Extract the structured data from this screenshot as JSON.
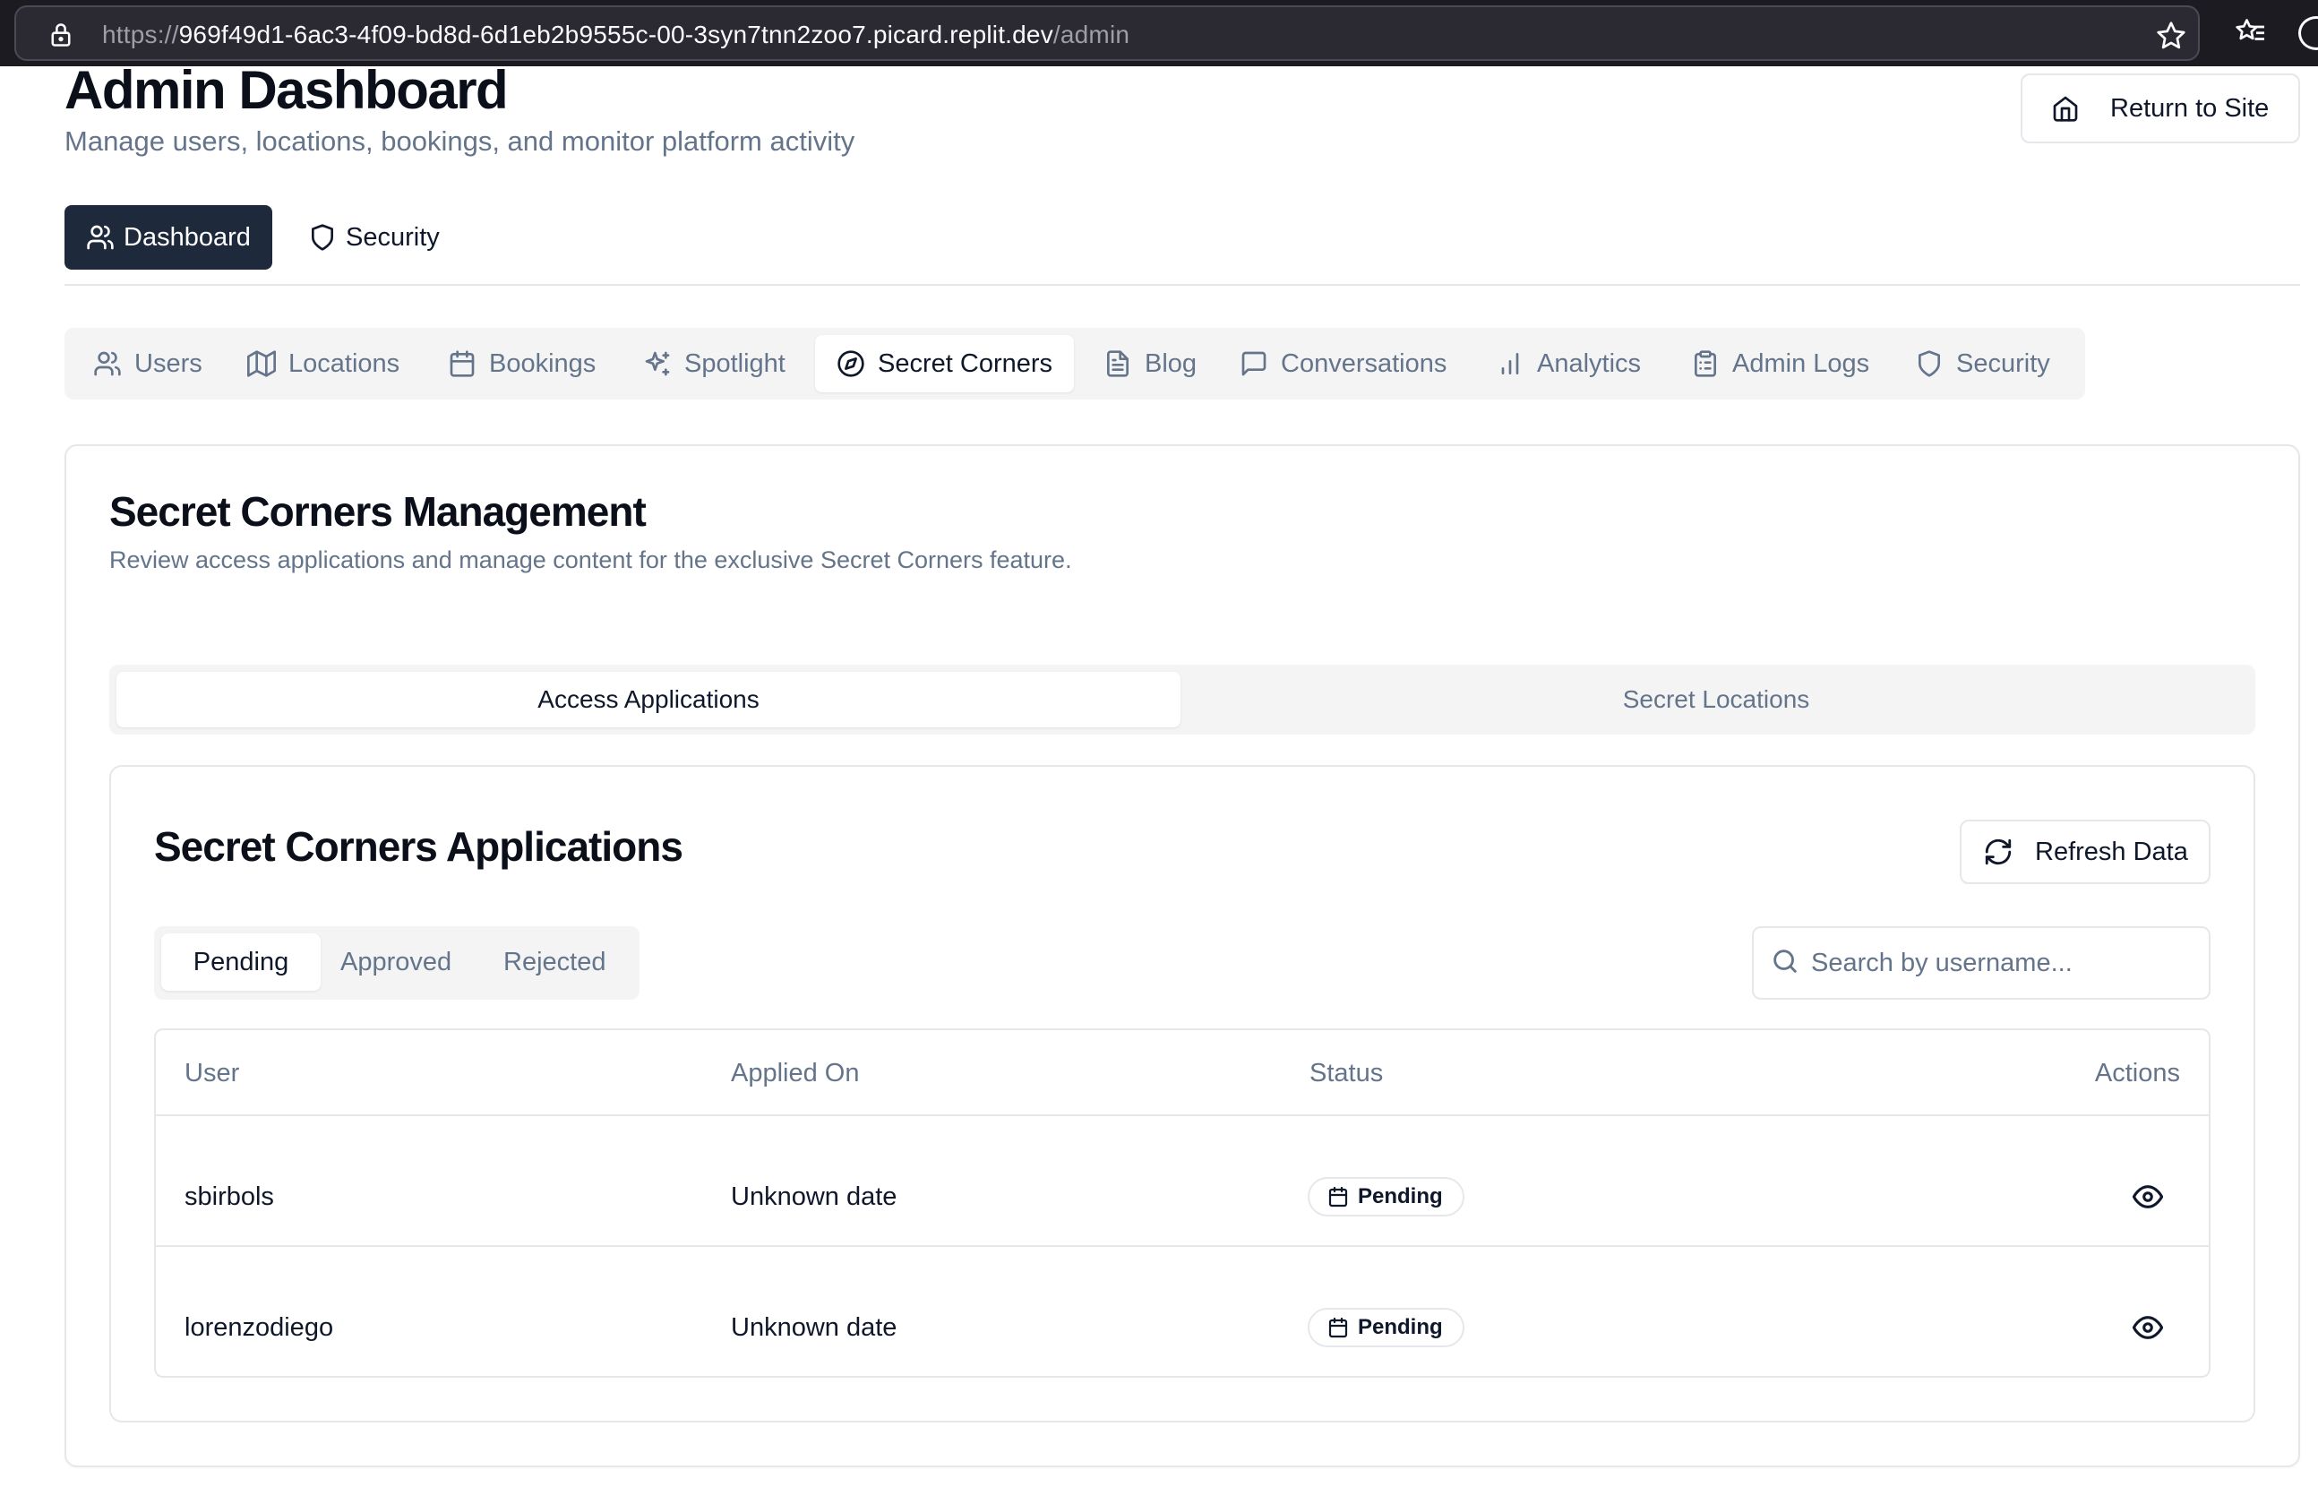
{
  "browser": {
    "url_prefix": "https://",
    "url_host": "969f49d1-6ac3-4f09-bd8d-6d1eb2b9555c-00-3syn7tnn2zoo7.picard.replit.dev",
    "url_path": "/admin"
  },
  "header": {
    "title": "Admin Dashboard",
    "subtitle": "Manage users, locations, bookings, and monitor platform activity",
    "return_label": "Return to Site"
  },
  "top_tabs": [
    {
      "label": "Dashboard",
      "icon": "users-icon",
      "active": true
    },
    {
      "label": "Security",
      "icon": "shield-icon",
      "active": false
    }
  ],
  "section_tabs": [
    {
      "label": "Users",
      "icon": "users-icon"
    },
    {
      "label": "Locations",
      "icon": "map-icon"
    },
    {
      "label": "Bookings",
      "icon": "calendar-icon"
    },
    {
      "label": "Spotlight",
      "icon": "sparkles-icon"
    },
    {
      "label": "Secret Corners",
      "icon": "compass-icon",
      "active": true
    },
    {
      "label": "Blog",
      "icon": "file-text-icon"
    },
    {
      "label": "Conversations",
      "icon": "message-square-icon"
    },
    {
      "label": "Analytics",
      "icon": "bar-chart-icon"
    },
    {
      "label": "Admin Logs",
      "icon": "clipboard-icon"
    },
    {
      "label": "Security",
      "icon": "shield-icon"
    }
  ],
  "main": {
    "title": "Secret Corners Management",
    "description": "Review access applications and manage content for the exclusive Secret Corners feature.",
    "sub_tabs": [
      "Access Applications",
      "Secret Locations"
    ],
    "applications": {
      "title": "Secret Corners Applications",
      "refresh_label": "Refresh Data",
      "status_tabs": [
        "Pending",
        "Approved",
        "Rejected"
      ],
      "search_placeholder": "Search by username...",
      "columns": [
        "User",
        "Applied On",
        "Status",
        "Actions"
      ],
      "rows": [
        {
          "user": "sbirbols",
          "applied_on": "Unknown date",
          "status": "Pending"
        },
        {
          "user": "lorenzodiego",
          "applied_on": "Unknown date",
          "status": "Pending"
        }
      ]
    }
  }
}
